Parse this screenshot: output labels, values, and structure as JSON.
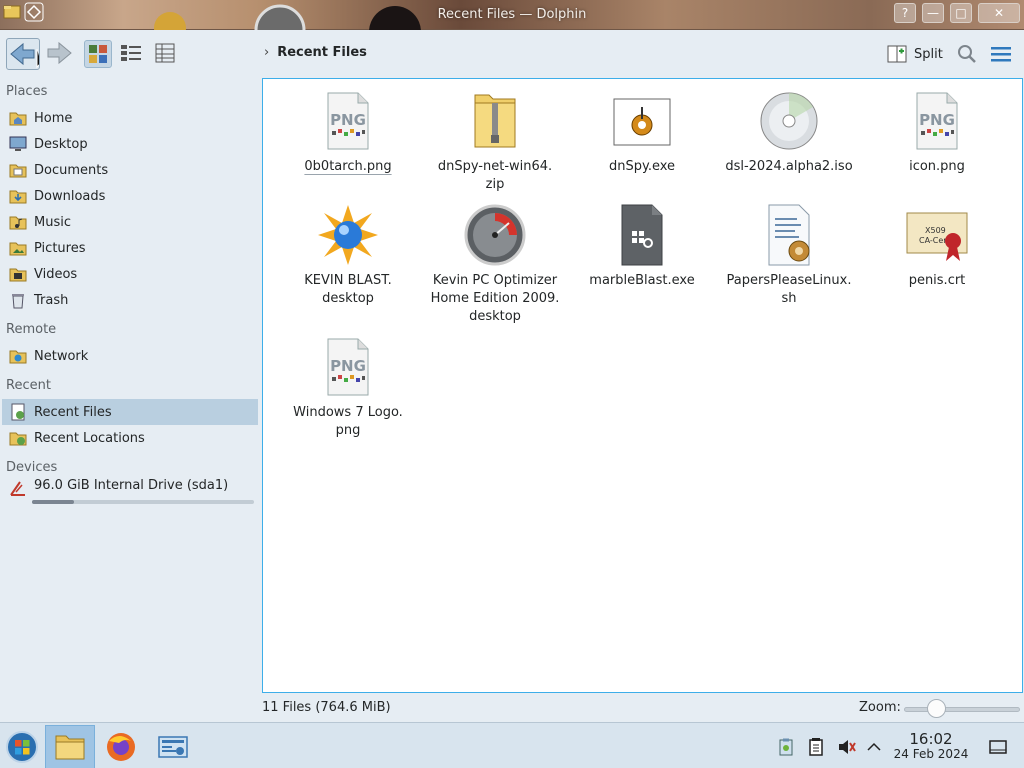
{
  "window": {
    "title": "Recent Files — Dolphin",
    "buttons": {
      "help": "?",
      "minimize": "—",
      "maximize": "□",
      "close": "✕"
    }
  },
  "toolbar": {
    "breadcrumb": "Recent Files",
    "split_label": "Split"
  },
  "sidebar": {
    "places_header": "Places",
    "places": [
      {
        "label": "Home",
        "icon": "home-folder-icon"
      },
      {
        "label": "Desktop",
        "icon": "desktop-icon"
      },
      {
        "label": "Documents",
        "icon": "documents-folder-icon"
      },
      {
        "label": "Downloads",
        "icon": "downloads-folder-icon"
      },
      {
        "label": "Music",
        "icon": "music-folder-icon"
      },
      {
        "label": "Pictures",
        "icon": "pictures-folder-icon"
      },
      {
        "label": "Videos",
        "icon": "videos-folder-icon"
      },
      {
        "label": "Trash",
        "icon": "trash-icon"
      }
    ],
    "remote_header": "Remote",
    "remote": [
      {
        "label": "Network",
        "icon": "network-folder-icon"
      }
    ],
    "recent_header": "Recent",
    "recent": [
      {
        "label": "Recent Files",
        "icon": "recent-files-icon",
        "selected": true
      },
      {
        "label": "Recent Locations",
        "icon": "recent-locations-icon"
      }
    ],
    "devices_header": "Devices",
    "devices": [
      {
        "label": "96.0 GiB Internal Drive (sda1)",
        "icon": "drive-icon",
        "usage": 0.19
      }
    ]
  },
  "files": [
    {
      "name": "0b0tarch.png",
      "icon": "png-image-icon"
    },
    {
      "name": "dnSpy-net-win64.\nzip",
      "icon": "zip-archive-icon"
    },
    {
      "name": "dnSpy.exe",
      "icon": "exe-gear-icon"
    },
    {
      "name": "dsl-2024.alpha2.iso",
      "icon": "disc-image-icon"
    },
    {
      "name": "icon.png",
      "icon": "png-image-icon"
    },
    {
      "name": "KEVIN BLAST.\ndesktop",
      "icon": "starburst-globe-icon"
    },
    {
      "name": "Kevin PC Optimizer\nHome Edition 2009.\ndesktop",
      "icon": "gauge-icon"
    },
    {
      "name": "marbleBlast.exe",
      "icon": "executable-file-icon"
    },
    {
      "name": "PapersPleaseLinux.\nsh",
      "icon": "shell-script-icon"
    },
    {
      "name": "penis.crt",
      "icon": "certificate-icon"
    },
    {
      "name": "Windows 7 Logo.\npng",
      "icon": "png-image-icon"
    }
  ],
  "statusbar": {
    "summary": "11 Files (764.6 MiB)",
    "zoom_label": "Zoom:",
    "zoom_level": 0.28
  },
  "taskbar": {
    "time": "16:02",
    "date": "24 Feb 2024",
    "apps": [
      {
        "name": "start-menu-icon"
      },
      {
        "name": "dolphin-file-manager-icon",
        "active": true
      },
      {
        "name": "firefox-icon"
      },
      {
        "name": "system-settings-icon"
      }
    ]
  },
  "colors": {
    "selection": "#b9cfe0",
    "accent": "#3daee9",
    "taskbar": "#d8e4ee"
  }
}
